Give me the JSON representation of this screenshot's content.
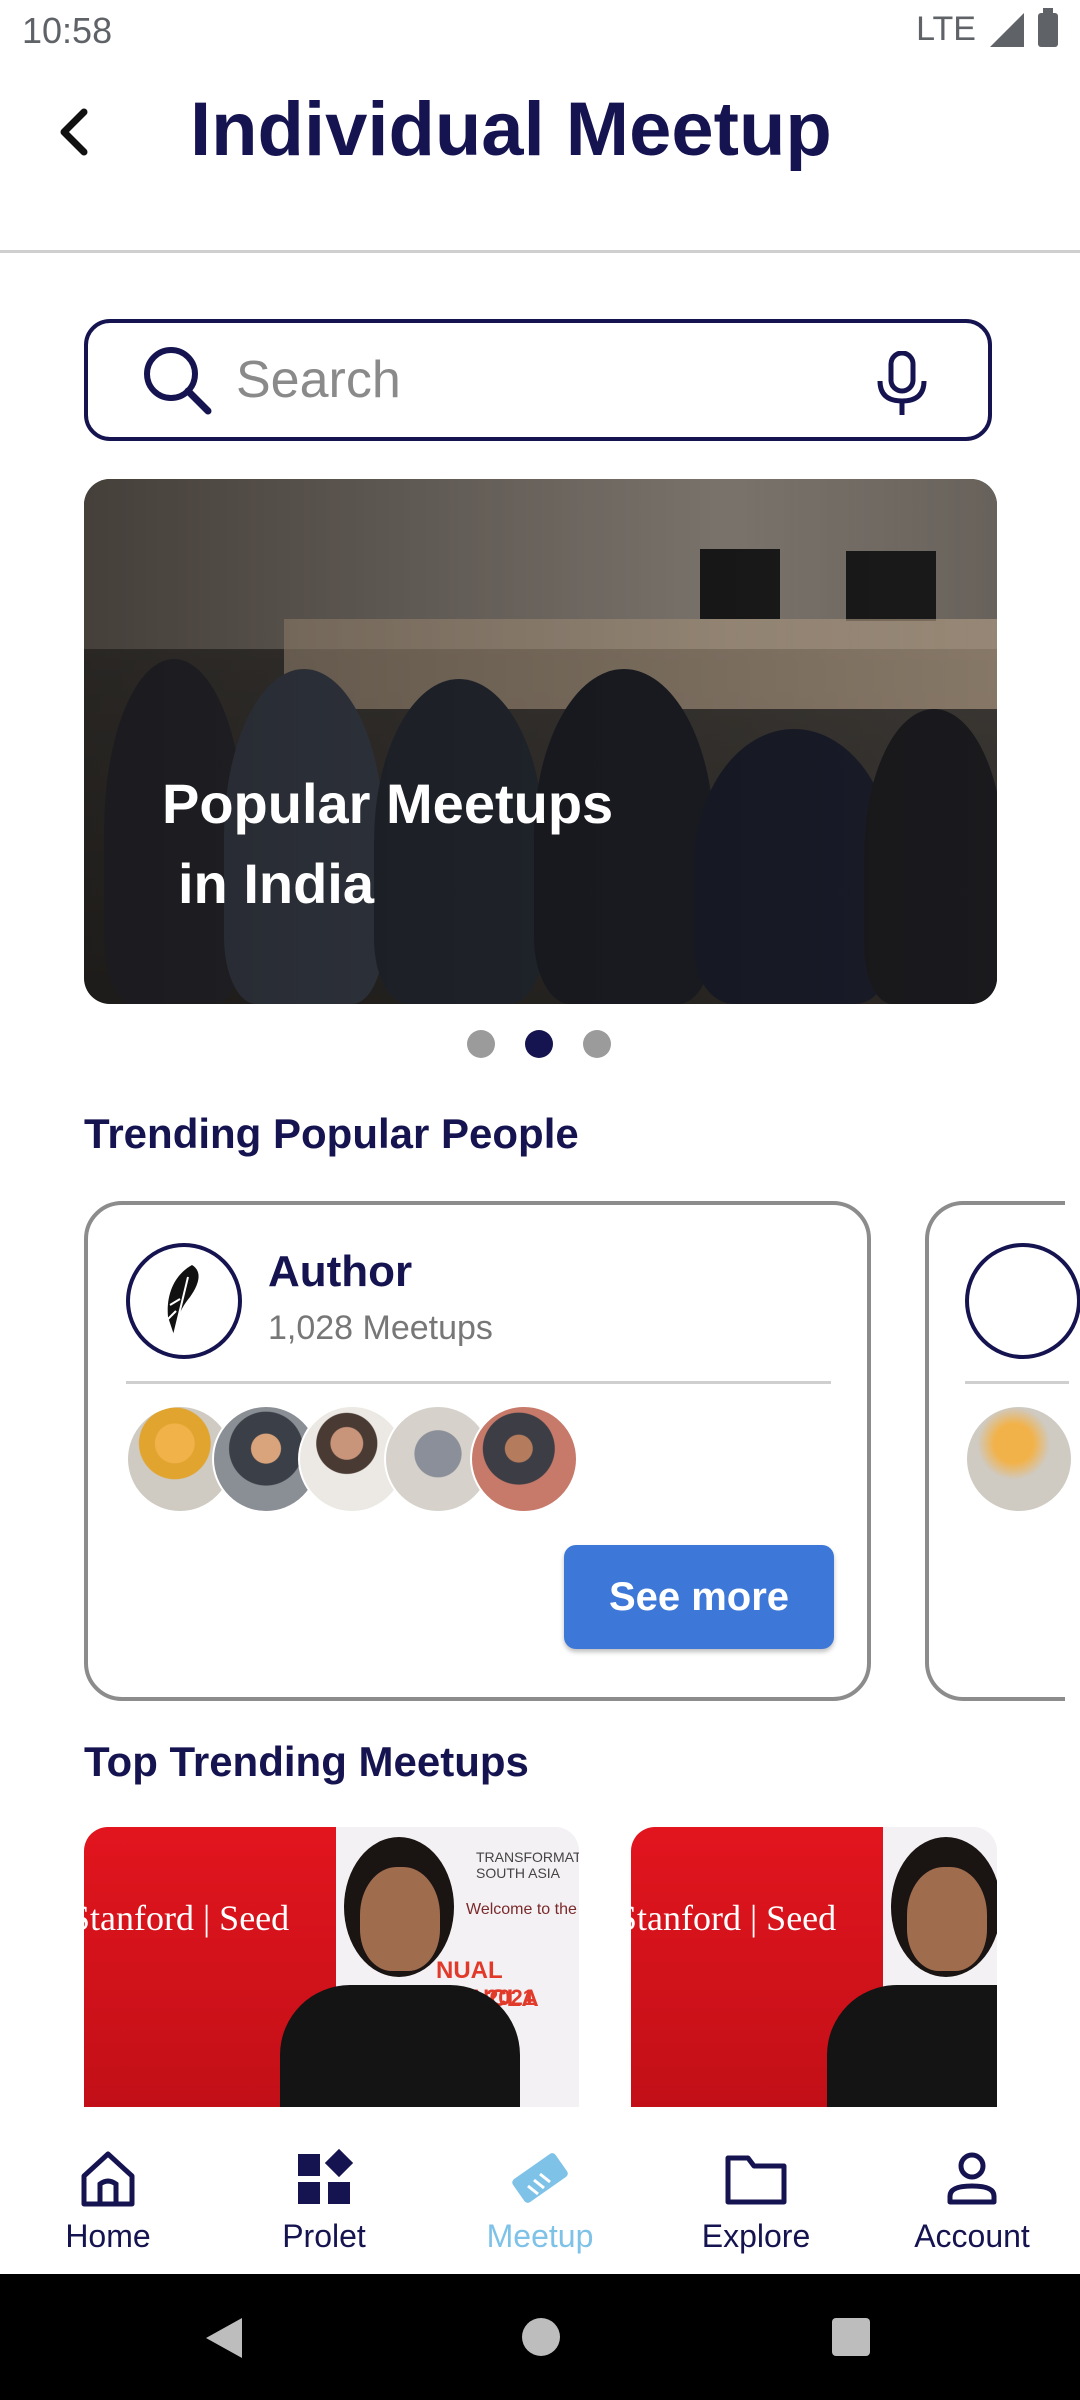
{
  "status_bar": {
    "time": "10:58",
    "network": "LTE"
  },
  "header": {
    "title": "Individual Meetup"
  },
  "search": {
    "placeholder": "Search"
  },
  "banner": {
    "line1": "Popular Meetups",
    "line2": "in India",
    "slide_index": 2,
    "slide_count": 3
  },
  "sections": {
    "people_title": "Trending Popular People",
    "meetups_title": "Top Trending Meetups"
  },
  "people_cards": [
    {
      "name": "Author",
      "count": "1,028 Meetups",
      "button": "See more"
    }
  ],
  "meetup_cards": [
    {
      "wall_text": "Stanford | Seed",
      "poster_top": "TRANSFORMATION SOUTH ASIA",
      "poster_welcome": "Welcome to the",
      "poster_banner": "NUAL CONCLA",
      "poster_year": "2021"
    },
    {
      "wall_text": "Stanford | Seed"
    }
  ],
  "bottom_nav": [
    {
      "label": "Home",
      "icon": "home-icon"
    },
    {
      "label": "Prolet",
      "icon": "apps-icon"
    },
    {
      "label": "Meetup",
      "icon": "handshake-icon",
      "active": true
    },
    {
      "label": "Explore",
      "icon": "folder-icon"
    },
    {
      "label": "Account",
      "icon": "person-icon"
    }
  ],
  "colors": {
    "primary": "#161450",
    "accent": "#3d78d8",
    "active_nav": "#7fc2e8"
  }
}
